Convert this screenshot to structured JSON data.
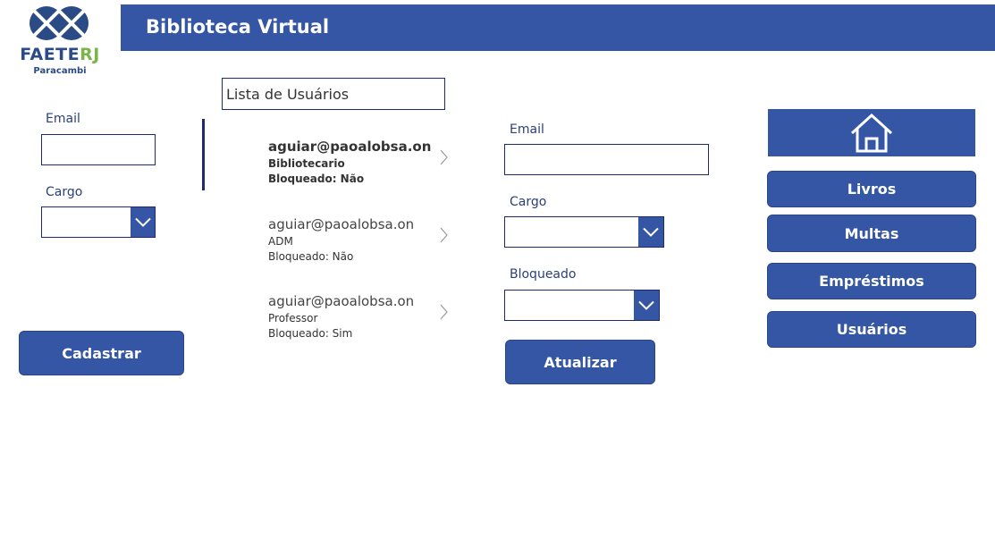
{
  "logo": {
    "brand_part1": "FAETE",
    "brand_part2": "RJ",
    "subtitle": "Paracambi"
  },
  "header": {
    "title": "Biblioteca Virtual"
  },
  "left_form": {
    "email_label": "Email",
    "email_value": "",
    "cargo_label": "Cargo",
    "cargo_value": "",
    "submit_label": "Cadastrar"
  },
  "list": {
    "title": "Lista de Usuários",
    "items": [
      {
        "email": "aguiar@paoalobsa.on",
        "cargo": "Bibliotecario",
        "bloqueado": "Bloqueado: Não"
      },
      {
        "email": "aguiar@paoalobsa.on",
        "cargo": "ADM",
        "bloqueado": "Bloqueado: Não"
      },
      {
        "email": "aguiar@paoalobsa.on",
        "cargo": "Professor",
        "bloqueado": "Bloqueado: Sim"
      }
    ]
  },
  "edit_form": {
    "email_label": "Email",
    "email_value": "",
    "cargo_label": "Cargo",
    "cargo_value": "",
    "bloqueado_label": "Bloqueado",
    "bloqueado_value": "",
    "submit_label": "Atualizar"
  },
  "nav": {
    "home_icon": "home-icon",
    "items": [
      {
        "label": "Livros"
      },
      {
        "label": "Multas"
      },
      {
        "label": "Empréstimos"
      },
      {
        "label": "Usuários"
      }
    ]
  },
  "colors": {
    "primary": "#3456a5",
    "border": "#1f2a6e",
    "brand_green": "#7ab54a"
  }
}
